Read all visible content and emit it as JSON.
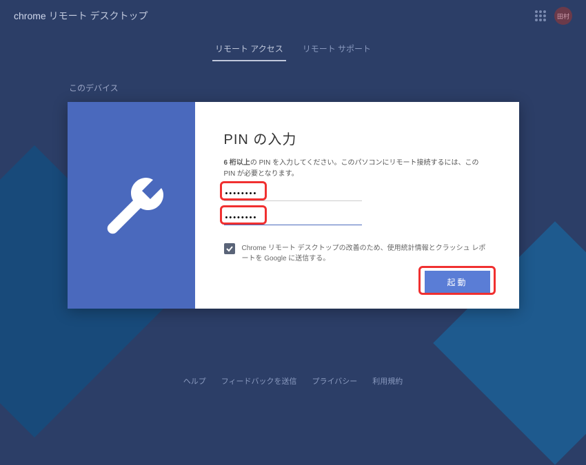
{
  "header": {
    "app_name_prefix": "chrome",
    "app_name_suffix": " リモート デスクトップ",
    "avatar_label": "田村"
  },
  "tabs": {
    "remote_access": "リモート アクセス",
    "remote_support": "リモート サポート"
  },
  "section": {
    "this_device": "このデバイス"
  },
  "dialog": {
    "title": "PIN の入力",
    "desc_bold": "6 桁以上",
    "desc_rest": "の PIN を入力してください。このパソコンにリモート接続するには、この PIN が必要となります。",
    "pin1": "••••••••",
    "pin2": "••••••••",
    "checkbox_label": "Chrome リモート デスクトップの改善のため、使用統計情報とクラッシュ レポートを Google に送信する。",
    "start_button": "起動"
  },
  "footer": {
    "help": "ヘルプ",
    "feedback": "フィードバックを送信",
    "privacy": "プライバシー",
    "terms": "利用規約"
  }
}
